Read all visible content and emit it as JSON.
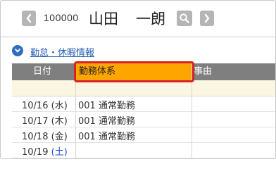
{
  "employee": {
    "id": "100000",
    "last_name": "山田",
    "first_name": "一朗"
  },
  "section": {
    "title": "勤怠・休暇情報"
  },
  "table": {
    "headers": {
      "date": "日付",
      "work_type": "勤務体系",
      "reason": "事由"
    },
    "rows": [
      {
        "date": "10/16",
        "weekday": "水",
        "work_type": "001 通常勤務"
      },
      {
        "date": "10/17",
        "weekday": "木",
        "work_type": "001 通常勤務"
      },
      {
        "date": "10/18",
        "weekday": "金",
        "work_type": "001 通常勤務"
      },
      {
        "date": "10/19",
        "weekday": "土",
        "work_type": ""
      }
    ]
  },
  "colors": {
    "header_bg": "#7f7f7f",
    "highlight_header": "#ffa500",
    "highlight_border": "#d62424",
    "link": "#2a62b5",
    "saturday": "#2a52c9",
    "filter_row": "#fbf6e2"
  },
  "icons": {
    "prev": "chevron-left-icon",
    "next": "chevron-right-icon",
    "search": "search-icon",
    "toggle": "chevron-down-icon"
  }
}
